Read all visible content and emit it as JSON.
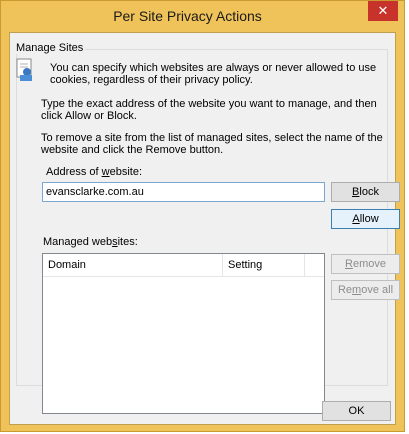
{
  "window": {
    "title": "Per Site Privacy Actions",
    "close_glyph": "✕",
    "accent_color": "#f0c35a"
  },
  "group": {
    "legend": "Manage Sites"
  },
  "texts": {
    "intro": "You can specify which websites are always or never allowed to use cookies, regardless of their privacy policy.",
    "type_instruction": "Type the exact address of the website you want to manage, and then click Allow or Block.",
    "remove_instruction": "To remove a site from the list of managed sites, select the name of the website and click the Remove button."
  },
  "address": {
    "label_pre": "Address of ",
    "label_ul": "w",
    "label_post": "ebsite:",
    "value": "evansclarke.com.au"
  },
  "buttons": {
    "block_ul": "B",
    "block_rest": "lock",
    "allow_ul": "A",
    "allow_rest": "llow",
    "remove_pre": "",
    "remove_ul": "R",
    "remove_rest": "emove",
    "removeall_pre": "Re",
    "removeall_ul": "m",
    "removeall_rest": "ove all",
    "ok": "OK"
  },
  "managed": {
    "label_pre": "Managed web",
    "label_ul": "s",
    "label_post": "ites:",
    "columns": [
      "Domain",
      "Setting"
    ],
    "rows": []
  }
}
